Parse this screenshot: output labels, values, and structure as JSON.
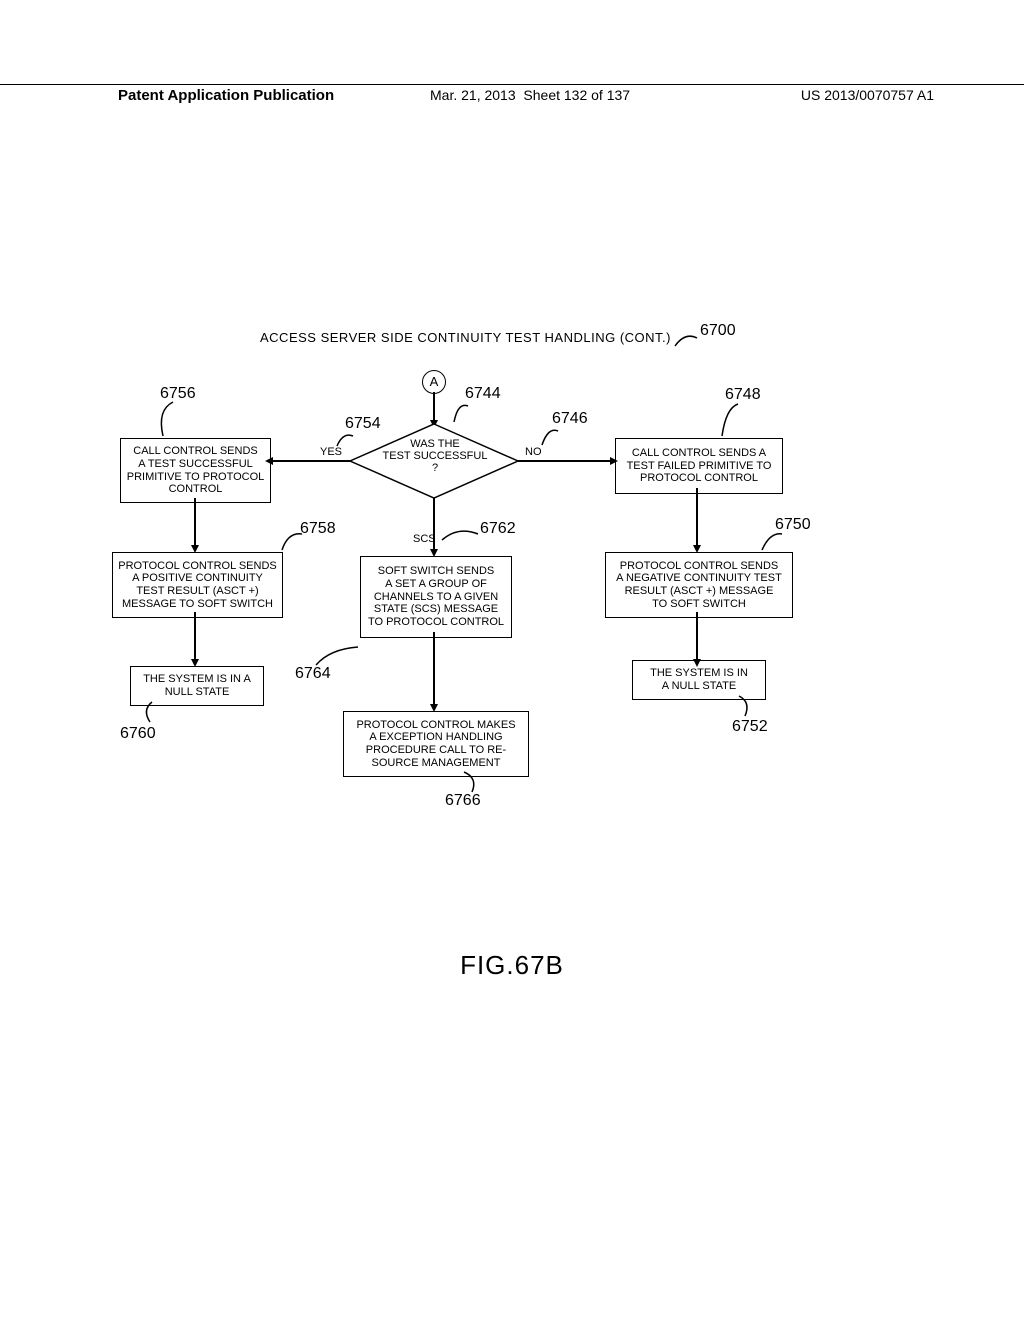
{
  "header": {
    "left": "Patent Application Publication",
    "date": "Mar. 21, 2013",
    "sheet": "Sheet 132 of 137",
    "pubno": "US 2013/0070757 A1"
  },
  "diagram": {
    "title": "ACCESS  SERVER  SIDE  CONTINUITY  TEST    HANDLING  (CONT.)",
    "ref_6700": "6700",
    "connector_a": "A",
    "ref_6744": "6744",
    "decision": "WAS THE\nTEST SUCCESSFUL\n?",
    "yes": "YES",
    "no": "NO",
    "ref_6754": "6754",
    "ref_6746": "6746",
    "ref_6756": "6756",
    "box_6756": "CALL CONTROL SENDS\nA TEST SUCCESSFUL\nPRIMITIVE TO PROTOCOL\nCONTROL",
    "ref_6748": "6748",
    "box_6748": "CALL CONTROL SENDS A\nTEST FAILED PRIMITIVE TO\nPROTOCOL CONTROL",
    "ref_6758": "6758",
    "box_6758": "PROTOCOL CONTROL SENDS\nA POSITIVE CONTINUITY\nTEST RESULT (ASCT +)\nMESSAGE TO SOFT SWITCH",
    "ref_6750": "6750",
    "box_6750": "PROTOCOL CONTROL SENDS\nA NEGATIVE CONTINUITY TEST\nRESULT (ASCT +) MESSAGE\nTO SOFT SWITCH",
    "ref_6760": "6760",
    "box_6760": "THE SYSTEM IS IN A\nNULL STATE",
    "ref_6752": "6752",
    "box_6752": "THE SYSTEM IS IN\nA NULL STATE",
    "scs": "SCS",
    "ref_6762": "6762",
    "ref_6764": "6764",
    "box_6764": "SOFT SWITCH SENDS\nA SET A GROUP OF\nCHANNELS TO A GIVEN\nSTATE (SCS) MESSAGE\nTO PROTOCOL CONTROL",
    "ref_6766": "6766",
    "box_6766": "PROTOCOL CONTROL MAKES\nA EXCEPTION HANDLING\nPROCEDURE CALL TO RE-\nSOURCE MANAGEMENT"
  },
  "figure_label": "FIG.67B"
}
